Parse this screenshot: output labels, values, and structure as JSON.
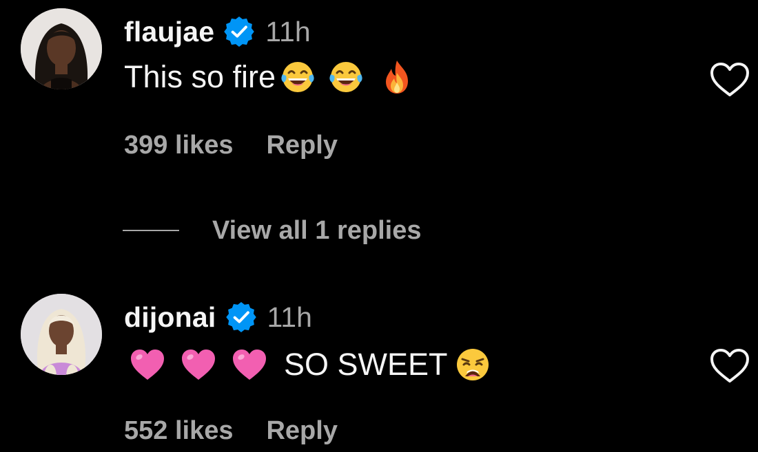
{
  "colors": {
    "background": "#000000",
    "primary_text": "#f5f5f5",
    "secondary_text": "#a8a8a8",
    "verified_blue": "#0095f6"
  },
  "comments": [
    {
      "username": "flaujae",
      "verified": true,
      "verified_icon": "verified-badge-icon",
      "time": "11h",
      "text": "This so fire",
      "emojis": [
        "tears-of-joy-emoji",
        "tears-of-joy-emoji",
        "fire-emoji"
      ],
      "likes": "399 likes",
      "reply_label": "Reply",
      "like_icon": "heart-outline-icon"
    },
    {
      "username": "dijonai",
      "verified": true,
      "verified_icon": "verified-badge-icon",
      "time": "11h",
      "text_emojis_before": [
        "pink-heart-emoji",
        "pink-heart-emoji",
        "pink-heart-emoji"
      ],
      "text": "SO SWEET",
      "emojis": [
        "weary-face-emoji"
      ],
      "likes": "552 likes",
      "reply_label": "Reply",
      "like_icon": "heart-outline-icon"
    }
  ],
  "view_replies": {
    "label": "View all 1 replies"
  }
}
